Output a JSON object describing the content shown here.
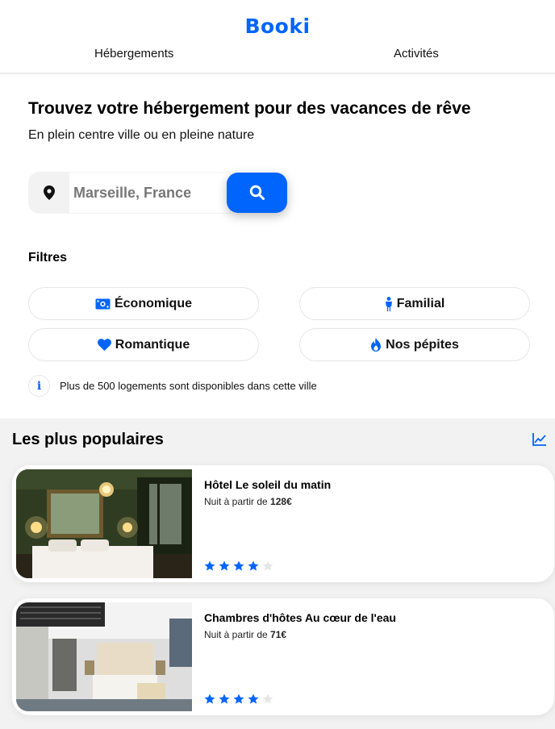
{
  "brand": {
    "logo": "Booki",
    "accent": "#0065fc"
  },
  "nav": {
    "items": [
      {
        "label": "Hébergements"
      },
      {
        "label": "Activités"
      }
    ]
  },
  "hero": {
    "title": "Trouvez votre hébergement pour des vacances de rêve",
    "subtitle": "En plein centre ville ou en pleine nature"
  },
  "search": {
    "placeholder": "Marseille, France",
    "pin_icon": "location-pin-icon",
    "button_icon": "search-icon"
  },
  "filters": {
    "title": "Filtres",
    "items": [
      {
        "label": "Économique",
        "icon": "money-icon"
      },
      {
        "label": "Familial",
        "icon": "person-icon"
      },
      {
        "label": "Romantique",
        "icon": "heart-icon"
      },
      {
        "label": "Nos pépites",
        "icon": "fire-icon"
      }
    ],
    "info_icon_label": "i",
    "info": "Plus de 500 logements sont disponibles dans cette ville"
  },
  "popular": {
    "title": "Les plus populaires",
    "chart_icon": "chart-line-icon",
    "cards": [
      {
        "name": "Hôtel Le soleil du matin",
        "price_prefix": "Nuit à partir de ",
        "price": "128€",
        "rating": 4,
        "max_rating": 5
      },
      {
        "name": "Chambres d'hôtes Au cœur de l'eau",
        "price_prefix": "Nuit à partir de ",
        "price": "71€",
        "rating": 4,
        "max_rating": 5
      }
    ]
  }
}
